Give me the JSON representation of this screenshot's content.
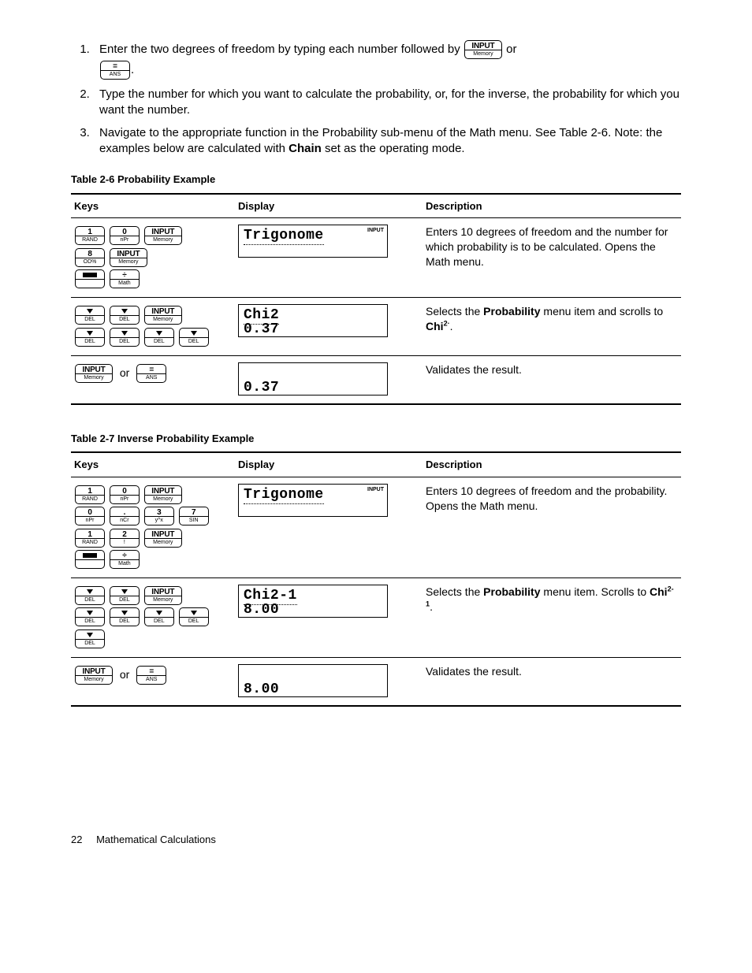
{
  "intro": {
    "step1_a": "Enter the two degrees of freedom by typing each number followed by ",
    "step1_b": " or ",
    "step1_c": ".",
    "step2": "Type the number for which you want to calculate the probability, or, for the inverse, the probability for which you want the number.",
    "step3_a": "Navigate to the appropriate function in the Probability sub-menu of the Math menu. See Table 2-6. Note: the examples below are calculated with ",
    "step3_bold": "Chain",
    "step3_b": " set as the operating mode."
  },
  "keys": {
    "input_top": "INPUT",
    "input_bot": "Memory",
    "eq_top": "=",
    "eq_bot": "ANS",
    "one_top": "1",
    "one_bot": "RAND",
    "zero_top": "0",
    "zero_bot": "nPr",
    "eight_top": "8",
    "eight_bot": "OD%",
    "div_top": "÷",
    "div_bot": "Math",
    "down_bot": "DEL",
    "dot_top": ".",
    "dot_bot": "nCr",
    "three_top": "3",
    "three_bot": "y^x",
    "seven_top": "7",
    "seven_bot": "SIN",
    "two_top": "2",
    "two_bot": "!"
  },
  "table1": {
    "caption": "Table 2-6 Probability Example",
    "h_keys": "Keys",
    "h_disp": "Display",
    "h_desc": "Description",
    "r1": {
      "lcd_main": "Trigonome",
      "lcd_corner": "INPUT",
      "desc": "Enters 10 degrees of freedom and the number for which probability is to be calculated. Opens the Math menu."
    },
    "r2": {
      "lcd_l1": "Chi2",
      "lcd_l2": "0.37",
      "desc_a": "Selects the ",
      "desc_bold": "Probability",
      "desc_b": " menu item and scrolls to ",
      "desc_c_pre": "Chi",
      "desc_c_sup": "2·",
      "desc_c_post": "."
    },
    "r3": {
      "or": "or",
      "lcd_l2": "0.37",
      "desc": "Validates the result."
    }
  },
  "table2": {
    "caption": "Table 2-7 Inverse Probability Example",
    "h_keys": "Keys",
    "h_disp": "Display",
    "h_desc": "Description",
    "r1": {
      "lcd_main": "Trigonome",
      "lcd_corner": "INPUT",
      "desc": "Enters 10 degrees of freedom and the probability. Opens the Math menu."
    },
    "r2": {
      "lcd_l1": "Chi2-1",
      "lcd_l2": "8.00",
      "desc_a": "Selects the ",
      "desc_bold": "Probability",
      "desc_b": " menu item. Scrolls to ",
      "desc_c_pre": "Chi",
      "desc_c_sup": "2-1",
      "desc_c_post": "."
    },
    "r3": {
      "or": "or",
      "lcd_l2": "8.00",
      "desc": "Validates the result."
    }
  },
  "footer": {
    "page": "22",
    "title": "Mathematical Calculations"
  }
}
